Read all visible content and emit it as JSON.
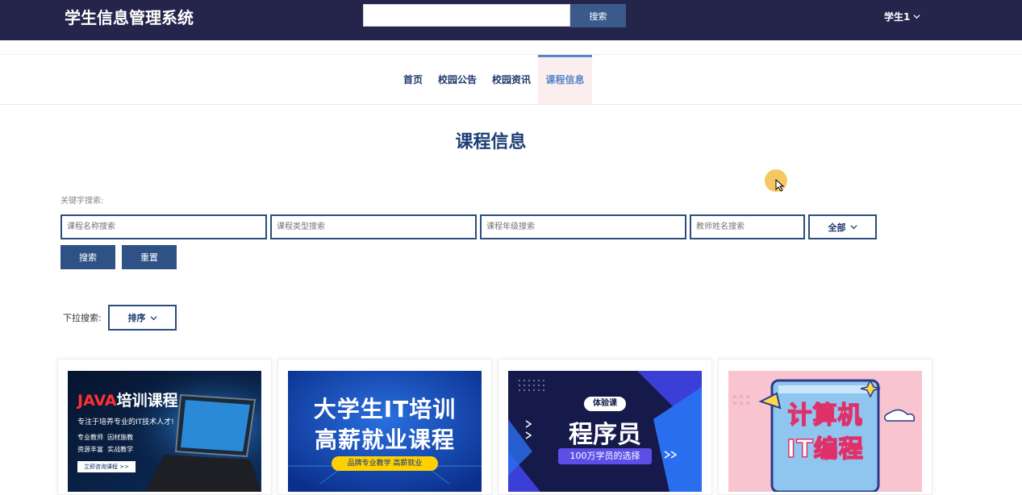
{
  "header": {
    "brand": "学生信息管理系统",
    "search_placeholder": "",
    "search_button": "搜索",
    "user": "学生1"
  },
  "nav": {
    "items": [
      {
        "label": "首页"
      },
      {
        "label": "校园公告"
      },
      {
        "label": "校园资讯"
      },
      {
        "label": "课程信息",
        "active": true
      }
    ]
  },
  "page": {
    "title": "课程信息",
    "keyword_label": "关键字搜索:",
    "filters": {
      "course_name_placeholder": "课程名称搜索",
      "course_type_placeholder": "课程类型搜索",
      "course_grade_placeholder": "课程年级搜索",
      "teacher_name_placeholder": "教师姓名搜索",
      "scope_select": "全部"
    },
    "search_button": "搜索",
    "reset_button": "重置",
    "dropdown_label": "下拉搜索:",
    "sort_select": "排序"
  },
  "cards": [
    {
      "title": "JAVA培训课程",
      "title_java": "JAVA",
      "title_rest": "培训课程",
      "subtitle": "专注于培养专业的IT技术人才!",
      "bullets": [
        "专业教师",
        "因材施教",
        "资源丰富",
        "实战教学"
      ],
      "cta": "立即咨询课程 >>"
    },
    {
      "line1": "大学生IT培训",
      "line2": "高薪就业课程",
      "tag": "品牌专业教学 高薪就业"
    },
    {
      "badge": "体验课",
      "title": "程序员",
      "tag": "100万学员的选择"
    },
    {
      "line1": "计算机",
      "line2": "IT编程"
    }
  ],
  "colors": {
    "header_bg": "#25244a",
    "accent": "#2f5286",
    "nav_active": "#5a86c8"
  }
}
